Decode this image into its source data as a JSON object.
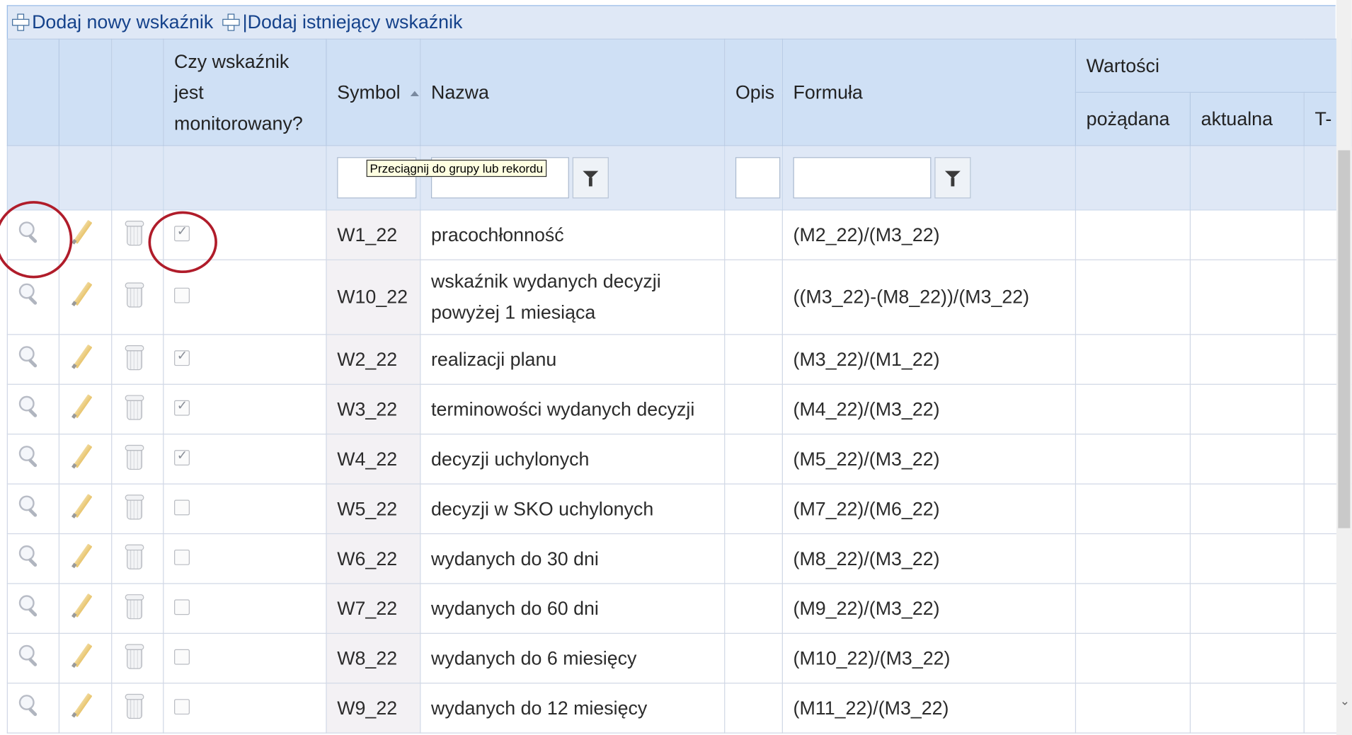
{
  "toolbar": {
    "add_new_label": "Dodaj nowy wskaźnik",
    "add_existing_label": "|Dodaj istniejący wskaźnik"
  },
  "columns": {
    "monitored_l1": "Czy wskaźnik",
    "monitored_l2": "jest",
    "monitored_l3": "monitorowany?",
    "symbol": "Symbol",
    "name": "Nazwa",
    "description": "Opis",
    "formula": "Formuła",
    "values_group": "Wartości",
    "desired": "pożądana",
    "actual": "aktualna",
    "next": "T-"
  },
  "tooltip": "Przeciągnij do grupy lub rekordu",
  "rows": [
    {
      "symbol": "W1_22",
      "name": "pracochłonność",
      "formula": "(M2_22)/(M3_22)",
      "monitored": true
    },
    {
      "symbol": "W10_22",
      "name_l1": "wskaźnik wydanych decyzji",
      "name_l2": "powyżej 1 miesiąca",
      "formula": "((M3_22)-(M8_22))/(M3_22)",
      "monitored": false
    },
    {
      "symbol": "W2_22",
      "name": "realizacji planu",
      "formula": "(M3_22)/(M1_22)",
      "monitored": true
    },
    {
      "symbol": "W3_22",
      "name": "terminowości wydanych decyzji",
      "formula": "(M4_22)/(M3_22)",
      "monitored": true
    },
    {
      "symbol": "W4_22",
      "name": "decyzji uchylonych",
      "formula": "(M5_22)/(M3_22)",
      "monitored": true
    },
    {
      "symbol": "W5_22",
      "name": "decyzji w SKO uchylonych",
      "formula": "(M7_22)/(M6_22)",
      "monitored": false
    },
    {
      "symbol": "W6_22",
      "name": "wydanych do 30 dni",
      "formula": "(M8_22)/(M3_22)",
      "monitored": false
    },
    {
      "symbol": "W7_22",
      "name": "wydanych do 60 dni",
      "formula": "(M9_22)/(M3_22)",
      "monitored": false
    },
    {
      "symbol": "W8_22",
      "name": "wydanych do 6 miesięcy",
      "formula": "(M10_22)/(M3_22)",
      "monitored": false
    },
    {
      "symbol": "W9_22",
      "name": "wydanych do 12 miesięcy",
      "formula": "(M11_22)/(M3_22)",
      "monitored": false
    }
  ],
  "colors": {
    "highlight": "#b01c2a",
    "header_bg": "#cfe0f5",
    "toolbar_text": "#15428b"
  }
}
